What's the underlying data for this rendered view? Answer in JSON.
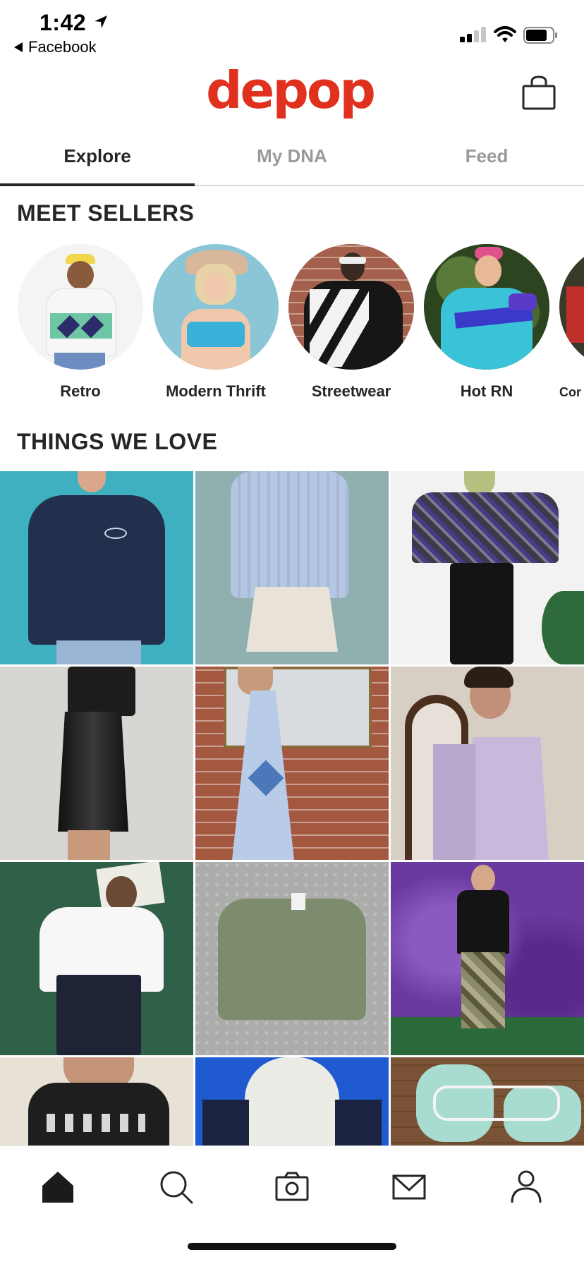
{
  "status_bar": {
    "time": "1:42",
    "back_app": "Facebook"
  },
  "header": {
    "logo": "depop",
    "brand_color": "#e0301e"
  },
  "tabs": [
    {
      "label": "Explore",
      "active": true
    },
    {
      "label": "My DNA",
      "active": false
    },
    {
      "label": "Feed",
      "active": false
    }
  ],
  "meet_sellers": {
    "title": "MEET SELLERS",
    "items": [
      {
        "label": "Retro"
      },
      {
        "label": "Modern Thrift"
      },
      {
        "label": "Streetwear"
      },
      {
        "label": "Hot RN"
      },
      {
        "label": "Cor"
      }
    ]
  },
  "things_we_love": {
    "title": "THINGS WE LOVE",
    "tiles": [
      {
        "icon": "navy-sweatshirt-photo"
      },
      {
        "icon": "blue-knit-sweater-photo"
      },
      {
        "icon": "patterned-sweater-leather-skirt-photo"
      },
      {
        "icon": "leather-skirt-corset-photo"
      },
      {
        "icon": "blue-maxi-dress-photo"
      },
      {
        "icon": "lavender-strapless-dress-photo"
      },
      {
        "icon": "white-ruffle-blouse-photo"
      },
      {
        "icon": "green-sweatshirt-photo"
      },
      {
        "icon": "black-tee-camo-pants-photo"
      },
      {
        "icon": "black-graphic-tee-photo"
      },
      {
        "icon": "fila-hoodie-photo"
      },
      {
        "icon": "mint-sneakers-photo"
      }
    ]
  },
  "bottom_nav": [
    {
      "icon": "home-icon",
      "active": true
    },
    {
      "icon": "search-icon",
      "active": false
    },
    {
      "icon": "camera-icon",
      "active": false
    },
    {
      "icon": "mail-icon",
      "active": false
    },
    {
      "icon": "profile-icon",
      "active": false
    }
  ]
}
